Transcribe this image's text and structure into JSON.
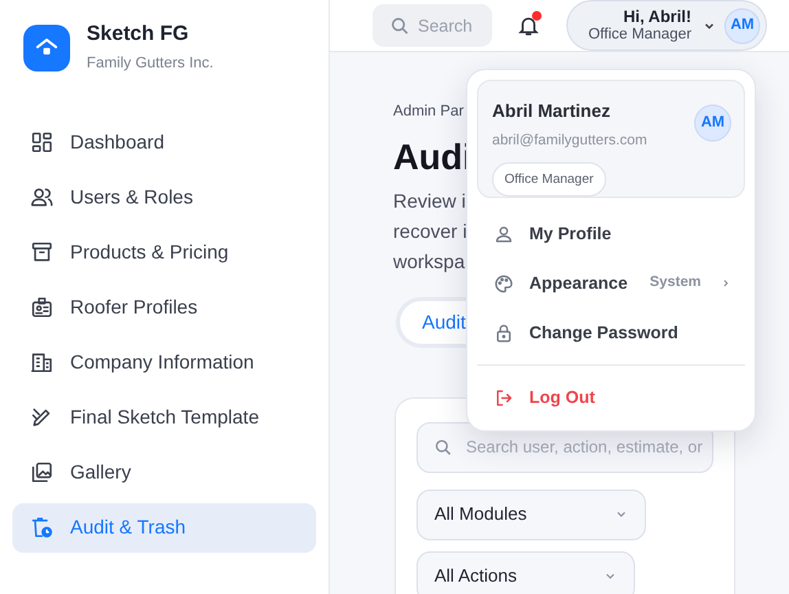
{
  "brand": {
    "name": "Sketch FG",
    "company": "Family Gutters Inc."
  },
  "sidebar": {
    "items": [
      {
        "label": "Dashboard",
        "selected": false
      },
      {
        "label": "Users & Roles",
        "selected": false
      },
      {
        "label": "Products & Pricing",
        "selected": false
      },
      {
        "label": "Roofer Profiles",
        "selected": false
      },
      {
        "label": "Company Information",
        "selected": false
      },
      {
        "label": "Final Sketch Template",
        "selected": false
      },
      {
        "label": "Gallery",
        "selected": false
      },
      {
        "label": "Audit & Trash",
        "selected": true
      }
    ]
  },
  "header": {
    "search_placeholder": "Search",
    "notifications_unread": true,
    "greeting": "Hi, Abril!",
    "role": "Office Manager",
    "avatar": "AM"
  },
  "user_menu": {
    "name": "Abril Martinez",
    "email": "abril@familygutters.com",
    "avatar": "AM",
    "role_badge": "Office Manager",
    "items": [
      {
        "kind": "link",
        "label": "My Profile"
      },
      {
        "kind": "submenu",
        "label": "Appearance",
        "value": "System"
      },
      {
        "kind": "link",
        "label": "Change Password"
      },
      {
        "kind": "danger",
        "label": "Log Out"
      }
    ]
  },
  "page": {
    "breadcrumb": "Admin Par",
    "title": "Audi",
    "description": [
      "Review i",
      "recover i",
      "workspa"
    ],
    "tabs": [
      {
        "label": "Audit",
        "selected": true
      }
    ],
    "filters": {
      "search_placeholder": "Search user, action, estimate, or",
      "selects": [
        "All Modules",
        "All Actions"
      ]
    }
  }
}
